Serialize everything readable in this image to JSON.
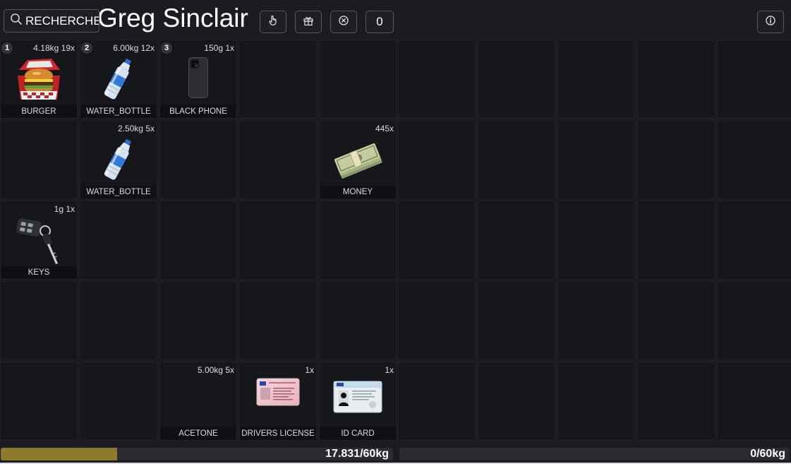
{
  "header": {
    "search_placeholder": "RECHERCHE",
    "player_name": "Greg Sinclair",
    "give_count": "0",
    "icons": [
      "search-icon",
      "hand-pointer-icon",
      "gift-icon",
      "close-circle-icon",
      "info-icon"
    ]
  },
  "player_inventory": {
    "slots": [
      {
        "num": "1",
        "meta": "4.18kg 19x",
        "label": "BURGER",
        "icon": "burger-icon"
      },
      {
        "num": "2",
        "meta": "6.00kg 12x",
        "label": "WATER_BOTTLE",
        "icon": "water-bottle-icon"
      },
      {
        "num": "3",
        "meta": "150g 1x",
        "label": "BLACK PHONE",
        "icon": "phone-icon"
      },
      {},
      {},
      {},
      {
        "meta": "2.50kg 5x",
        "label": "WATER_BOTTLE",
        "icon": "water-bottle-icon"
      },
      {},
      {},
      {
        "meta": "445x",
        "label": "MONEY",
        "icon": "money-icon"
      },
      {
        "meta": "1g 1x",
        "label": "KEYS",
        "icon": "keys-icon"
      },
      {},
      {},
      {},
      {},
      {},
      {},
      {},
      {},
      {},
      {},
      {},
      {
        "meta": "5.00kg 5x",
        "label": "ACETONE"
      },
      {
        "meta": "1x",
        "label": "DRIVERS LICENSE",
        "icon": "drivers-license-icon"
      },
      {
        "meta": "1x",
        "label": "ID CARD",
        "icon": "id-card-icon"
      }
    ],
    "weight_text": "17.831/60kg",
    "weight_fraction": 0.297
  },
  "other_inventory": {
    "weight_text": "0/60kg",
    "weight_fraction": 0
  },
  "colors": {
    "background": "#1b1c21",
    "slot": "#16171b",
    "weight_fill": "#8d7a2b"
  }
}
